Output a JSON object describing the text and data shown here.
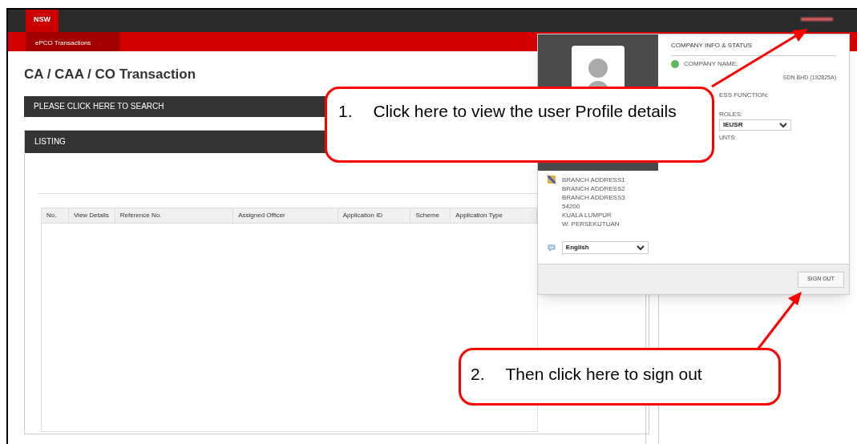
{
  "topbar": {
    "brand": "NSW"
  },
  "menu": {
    "items": [
      {
        "label": "ePCO Transactions",
        "selected": true
      }
    ]
  },
  "page": {
    "title": "CA / CAA / CO Transaction"
  },
  "search_panel": {
    "label": "PLEASE CLICK HERE TO SEARCH"
  },
  "listing": {
    "label": "LISTING",
    "columns": [
      "No.",
      "View Details",
      "Reference No.",
      "Assigned Officer",
      "Application ID",
      "Scheme",
      "Application Type"
    ]
  },
  "profile_panel": {
    "address": [
      "BRANCH ADDRESS1",
      "BRANCH ADDRESS2",
      "BRANCH ADDRESS3",
      "54200",
      "KUALA LUMPUR",
      "W. PERSEKUTUAN"
    ],
    "language": "English",
    "sign_out": "SIGN OUT"
  },
  "company_panel": {
    "title": "COMPANY INFO & STATUS",
    "company_label": "COMPANY NAME:",
    "company_name": "SDN BHD (192825A)",
    "function_label": "ESS FUNCTION:",
    "roles_label": "ROLES:",
    "role": "IEUSR",
    "accounts_label": "UNTS:"
  },
  "callouts": [
    {
      "number": "1.",
      "text": "Click here to view the user Profile details"
    },
    {
      "number": "2.",
      "text": "Then click here to sign out"
    }
  ]
}
